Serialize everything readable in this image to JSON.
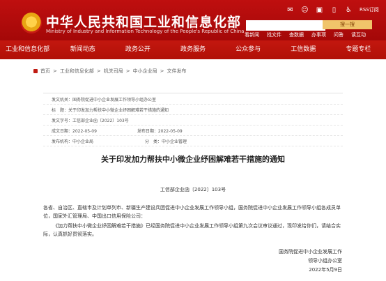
{
  "header": {
    "title": "中华人民共和国工业和信息化部",
    "subtitle": "Ministry of Industry and Information Technology of the People's Republic of China",
    "tools": [
      "RSS订阅"
    ],
    "search_button": "搜一搜",
    "quick_links": [
      "看新闻",
      "找文件",
      "查数据",
      "办事项",
      "问答",
      "读互动"
    ]
  },
  "nav": {
    "items": [
      "工业和信息化部",
      "新闻动态",
      "政务公开",
      "政务服务",
      "公众参与",
      "工信数据",
      "专题专栏"
    ]
  },
  "breadcrumb": [
    "首页",
    "工业和信息化部",
    "机关司局",
    "中小企业局",
    "文件发布"
  ],
  "doc": {
    "meta": [
      {
        "label": "发文机关：",
        "value": "国务院促进中小企业发展工作领导小组办公室"
      },
      {
        "label": "标　题：",
        "value": "关于印发加力帮扶中小微企业纾困解难若干措施的通知"
      },
      {
        "label": "发文字号：",
        "value": "工信部企业函〔2022〕103号"
      },
      {
        "label": "成文日期：",
        "value": "2022-05-09",
        "label2": "发布日期：",
        "value2": "2022-05-09"
      },
      {
        "label": "发布机构：",
        "value": "中小企业局",
        "label2": "分　类：",
        "value2": "中小企业管理"
      }
    ],
    "title": "关于印发加力帮扶中小微企业纾困解难若干措施的通知",
    "docnum": "工信部企业函〔2022〕103号",
    "paragraphs": [
      "各省、自治区、直辖市及计划单列市、新疆生产建设兵团促进中小企业发展工作领导小组，国务院促进中小企业发展工作领导小组各成员单位，国家外汇管理局、中国出口信用保险公司：",
      "《加力帮扶中小微企业纾困解难若干措施》已经国务院促进中小企业发展工作领导小组第九次会议审议通过，现印发给你们，请结合实际，认真抓好贯彻落实。"
    ],
    "sign": [
      "国务院促进中小企业发展工作",
      "领导小组办公室",
      "2022年5月9日"
    ]
  }
}
